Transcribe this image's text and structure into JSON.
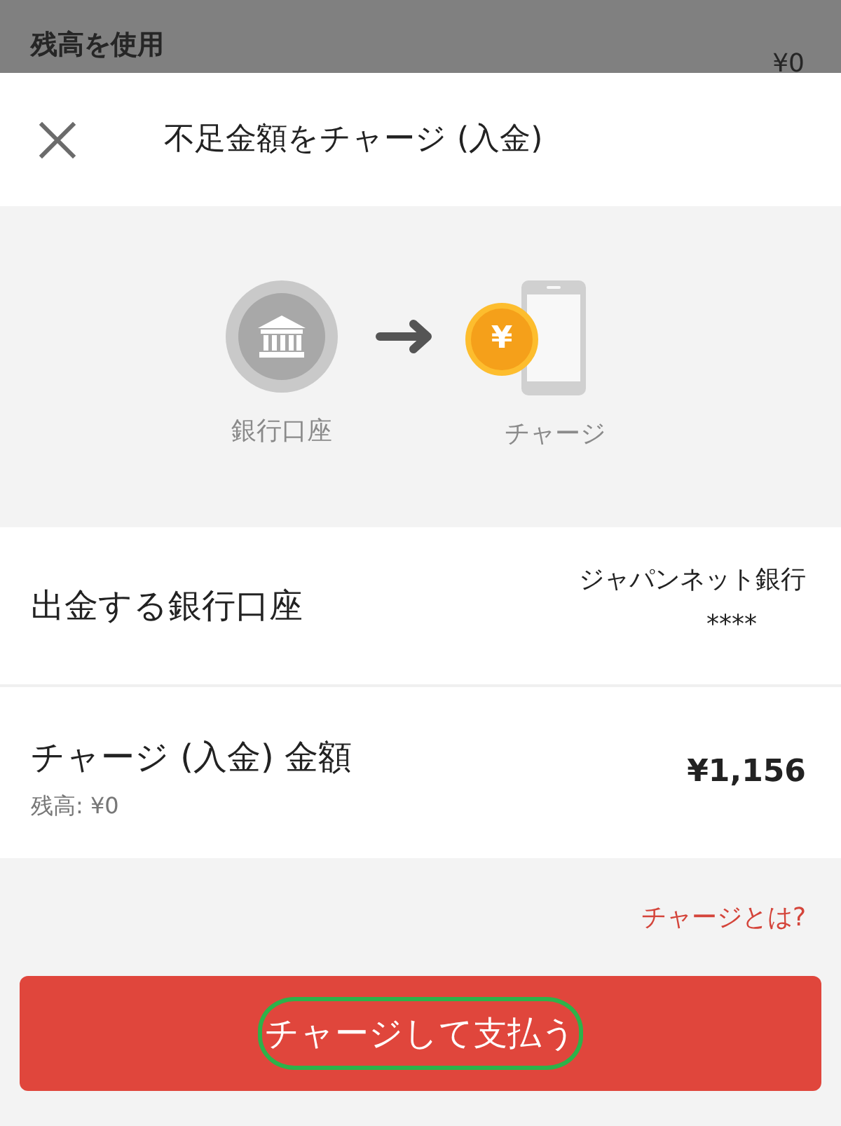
{
  "backdrop": {
    "title": "残高を使用",
    "amount": "¥0"
  },
  "sheet": {
    "title": "不足金額をチャージ (入金)"
  },
  "flow": {
    "from_label": "銀行口座",
    "coin_symbol": "¥",
    "to_label": "チャージ"
  },
  "rows": [
    {
      "kind": "account",
      "label": "出金する銀行口座",
      "value": "ジャパンネット銀行",
      "detail": "****"
    },
    {
      "kind": "amount",
      "label": "チャージ (入金) 金額",
      "sublabel": "残高: ¥0",
      "value": "¥1,156"
    }
  ],
  "help_link": "チャージとは?",
  "primary_button": {
    "label": "チャージして支払う",
    "highlighted": true
  }
}
